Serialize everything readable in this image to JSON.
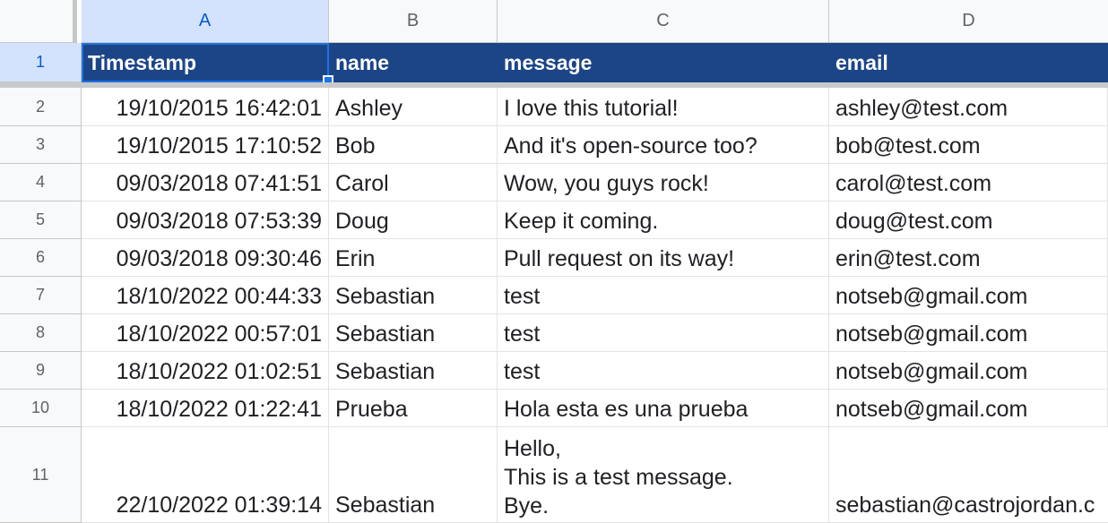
{
  "columns": [
    "A",
    "B",
    "C",
    "D"
  ],
  "row_numbers": [
    "1",
    "2",
    "3",
    "4",
    "5",
    "6",
    "7",
    "8",
    "9",
    "10",
    "11"
  ],
  "header": {
    "timestamp": "Timestamp",
    "name": "name",
    "message": "message",
    "email": "email"
  },
  "rows": [
    {
      "timestamp": "19/10/2015 16:42:01",
      "name": "Ashley",
      "message": "I love this tutorial!",
      "email": "ashley@test.com"
    },
    {
      "timestamp": "19/10/2015 17:10:52",
      "name": "Bob",
      "message": "And it's open-source too?",
      "email": "bob@test.com"
    },
    {
      "timestamp": "09/03/2018 07:41:51",
      "name": "Carol",
      "message": "Wow, you guys rock!",
      "email": "carol@test.com"
    },
    {
      "timestamp": "09/03/2018 07:53:39",
      "name": "Doug",
      "message": "Keep it coming.",
      "email": "doug@test.com"
    },
    {
      "timestamp": "09/03/2018 09:30:46",
      "name": "Erin",
      "message": "Pull request on its way!",
      "email": "erin@test.com"
    },
    {
      "timestamp": "18/10/2022 00:44:33",
      "name": "Sebastian",
      "message": "test",
      "email": "notseb@gmail.com"
    },
    {
      "timestamp": "18/10/2022 00:57:01",
      "name": "Sebastian",
      "message": "test",
      "email": "notseb@gmail.com"
    },
    {
      "timestamp": "18/10/2022 01:02:51",
      "name": "Sebastian",
      "message": "test",
      "email": "notseb@gmail.com"
    },
    {
      "timestamp": "18/10/2022 01:22:41",
      "name": "Prueba",
      "message": "Hola esta es una prueba",
      "email": "notseb@gmail.com"
    },
    {
      "timestamp": "22/10/2022 01:39:14",
      "name": "Sebastian",
      "message_lines": [
        "Hello,",
        "This is a test message.",
        "Bye."
      ],
      "email": "sebastian@castrojordan.c"
    }
  ],
  "colors": {
    "header_fill": "#1c4587",
    "selection": "#1a73e8"
  }
}
